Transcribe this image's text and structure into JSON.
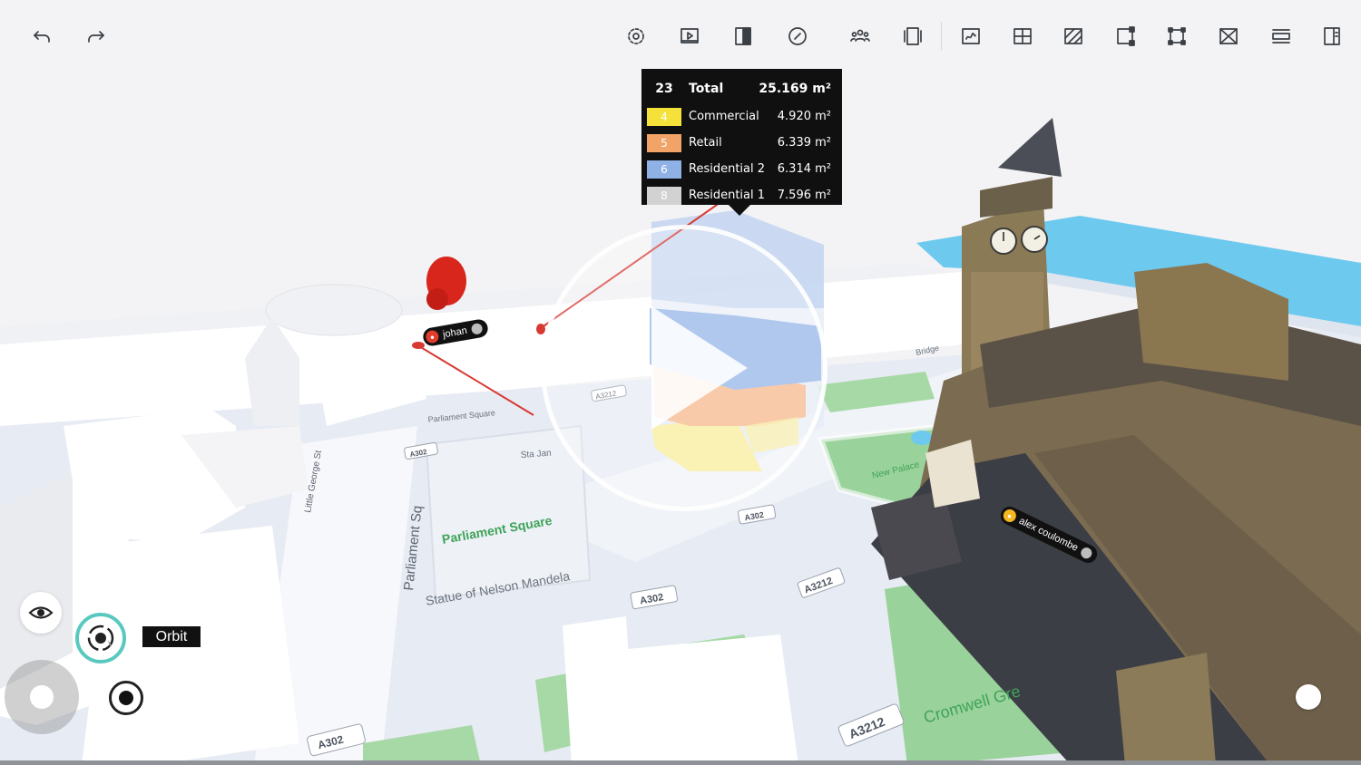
{
  "toolbar": {
    "buttons": [
      {
        "name": "undo-button",
        "icon": "undo-icon"
      },
      {
        "name": "redo-button",
        "icon": "redo-icon"
      },
      {
        "name": "settings-button",
        "icon": "gear-icon"
      },
      {
        "name": "presentation-button",
        "icon": "play-screen-icon"
      },
      {
        "name": "split-view-button",
        "icon": "split-view-icon"
      },
      {
        "name": "compass-button",
        "icon": "compass-icon"
      },
      {
        "name": "collaborators-button",
        "icon": "people-icon"
      },
      {
        "name": "frame-button",
        "icon": "frame-icon"
      },
      {
        "name": "draw-button",
        "icon": "draw-icon"
      },
      {
        "name": "grid-button",
        "icon": "grid-icon"
      },
      {
        "name": "hatch-button",
        "icon": "hatch-icon"
      },
      {
        "name": "edit-shape-button",
        "icon": "edit-shape-icon"
      },
      {
        "name": "select-area-button",
        "icon": "select-area-icon"
      },
      {
        "name": "remove-button",
        "icon": "remove-box-icon"
      },
      {
        "name": "section-button",
        "icon": "section-icon"
      },
      {
        "name": "panel-button",
        "icon": "side-panel-icon"
      }
    ]
  },
  "stats": {
    "total": {
      "count": "23",
      "label": "Total",
      "value": "25.169",
      "unit": "m²"
    },
    "rows": [
      {
        "count": "4",
        "label": "Commercial",
        "value": "4.920",
        "unit": "m²",
        "color": "#f4e23a"
      },
      {
        "count": "5",
        "label": "Retail",
        "value": "6.339",
        "unit": "m²",
        "color": "#f2a468"
      },
      {
        "count": "6",
        "label": "Residential 2",
        "value": "6.314",
        "unit": "m²",
        "color": "#8fb1e6"
      },
      {
        "count": "8",
        "label": "Residential 1",
        "value": "7.596",
        "unit": "m²",
        "color": "#d2d2d2"
      }
    ]
  },
  "users": [
    {
      "name": "johan",
      "color": "#e23c2c"
    },
    {
      "name": "alex coulombe",
      "color": "#f5b81f"
    }
  ],
  "map_labels": {
    "parliament_square_sm": "Parliament Square",
    "parliament_square": "Parliament Square",
    "parliament_sq": "Parliament Sq",
    "nelson_mandela": "Statue of Nelson Mandela",
    "little_george": "Little George St",
    "new_palace": "New Palace",
    "cromwell": "Cromwell Gre",
    "road_a302_1": "A302",
    "road_a302_2": "A302",
    "road_a302_3": "A302",
    "road_a302_4": "A302",
    "road_a3212_1": "A3212",
    "road_a3212_2": "A3212",
    "road_a3212_3": "A3212",
    "bridge": "Bridge",
    "sta_jan": "Sta Jan"
  },
  "controls": {
    "orbit_label": "Orbit",
    "visibility_icon": "eye-icon",
    "orbit_icon": "orbit-icon",
    "record_icon": "record-icon"
  },
  "overlay": {
    "play_icon": "play-icon"
  }
}
